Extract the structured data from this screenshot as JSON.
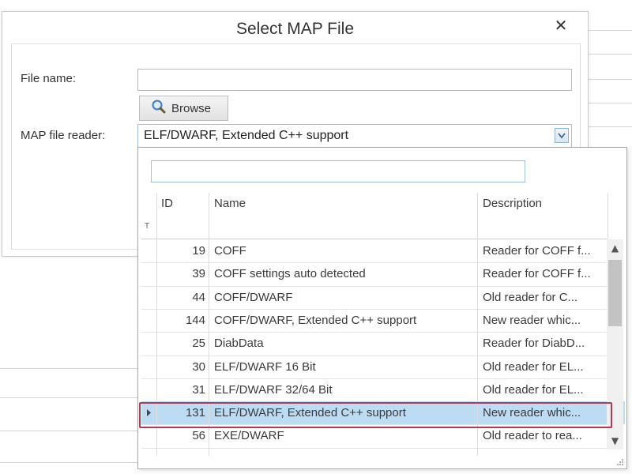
{
  "dialog": {
    "title": "Select MAP File",
    "close_symbol": "✕",
    "file_name_label": "File name:",
    "file_name_value": "",
    "browse_label": "Browse",
    "reader_label": "MAP file reader:",
    "reader_value": "ELF/DWARF, Extended C++ support"
  },
  "dropdown": {
    "search_value": "",
    "columns": {
      "id": "ID",
      "name": "Name",
      "description": "Description"
    },
    "filter_symbol": "T",
    "selected_index": 7,
    "rows": [
      {
        "id": "19",
        "name": "COFF",
        "description": "Reader for COFF f..."
      },
      {
        "id": "39",
        "name": "COFF settings auto detected",
        "description": "Reader for COFF f..."
      },
      {
        "id": "44",
        "name": "COFF/DWARF",
        "description": "Old reader for C..."
      },
      {
        "id": "144",
        "name": "COFF/DWARF, Extended C++ support",
        "description": "New reader whic..."
      },
      {
        "id": "25",
        "name": "DiabData",
        "description": "Reader for DiabD..."
      },
      {
        "id": "30",
        "name": "ELF/DWARF 16 Bit",
        "description": "Old reader for EL..."
      },
      {
        "id": "31",
        "name": "ELF/DWARF 32/64 Bit",
        "description": "Old reader for EL..."
      },
      {
        "id": "131",
        "name": "ELF/DWARF, Extended C++ support",
        "description": "New reader whic..."
      },
      {
        "id": "56",
        "name": "EXE/DWARF",
        "description": "Old reader to rea..."
      }
    ],
    "icons": {
      "browse": "magnifier-icon",
      "select_arrow": "chevron-down-icon",
      "row_indicator": "triangle-right-icon",
      "scroll_up": "▲",
      "scroll_down": "▼"
    }
  },
  "colors": {
    "selected_row": "#bcdcf3",
    "selection_frame": "#b13a57",
    "input_border": "#9ec0da"
  }
}
